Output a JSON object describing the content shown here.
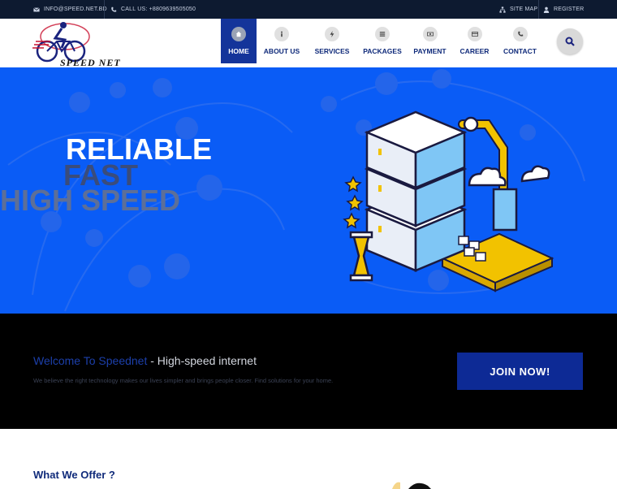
{
  "topbar": {
    "email": "INFO@SPEED.NET.BD",
    "phone": "CALL US: +8809639505050",
    "sitemap": "SITE MAP",
    "register": "REGISTER"
  },
  "brand": {
    "logo_text": "SPEED NET"
  },
  "nav": {
    "items": [
      {
        "label": "HOME",
        "icon": "home-icon",
        "active": true
      },
      {
        "label": "ABOUT US",
        "icon": "info-icon",
        "active": false
      },
      {
        "label": "SERVICES",
        "icon": "bolt-icon",
        "active": false
      },
      {
        "label": "PACKAGES",
        "icon": "list-icon",
        "active": false
      },
      {
        "label": "PAYMENT",
        "icon": "money-icon",
        "active": false
      },
      {
        "label": "CAREER",
        "icon": "card-icon",
        "active": false
      },
      {
        "label": "CONTACT",
        "icon": "phone-icon",
        "active": false
      }
    ]
  },
  "hero": {
    "line1": "RELIABLE",
    "line2": "FAST",
    "line3": "HIGH SPEED"
  },
  "welcome": {
    "title_accent": "Welcome To Speednet",
    "title_rest": " - High-speed internet",
    "subtitle": "We believe the right technology makes our lives simpler and brings people closer. Find solutions for your home.",
    "join_label": "JOIN NOW!"
  },
  "offer": {
    "title": "What We Offer ?"
  },
  "colors": {
    "topbar_bg": "#0d1a30",
    "nav_active": "#14349a",
    "hero_bg": "#0a5cf6",
    "join_bg": "#0d2a95",
    "accent_text": "#0f2a7a"
  }
}
